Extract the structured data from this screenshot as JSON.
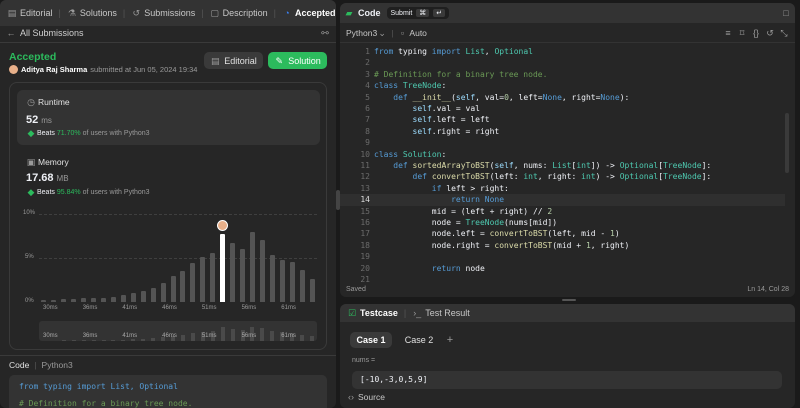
{
  "left_tabs": {
    "editorial": "Editorial",
    "solutions": "Solutions",
    "submissions": "Submissions",
    "description": "Description",
    "accepted": "Accepted"
  },
  "back_label": "All Submissions",
  "status": {
    "title": "Accepted",
    "user": "Aditya Raj Sharma",
    "submitted": "submitted at Jun 05, 2024 19:34"
  },
  "buttons": {
    "editorial": "Editorial",
    "solution": "Solution"
  },
  "runtime": {
    "label": "Runtime",
    "value": "52",
    "unit": "ms",
    "beats_prefix": "Beats",
    "beats_pct": "71.70%",
    "beats_suffix": "of users with Python3"
  },
  "memory": {
    "label": "Memory",
    "value": "17.68",
    "unit": "MB",
    "beats_prefix": "Beats",
    "beats_pct": "95.84%",
    "beats_suffix": "of users with Python3"
  },
  "chart_data": {
    "type": "bar",
    "yticks": [
      "10%",
      "5%",
      "0%"
    ],
    "ylim": [
      0,
      10
    ],
    "xticks": [
      "30ms",
      "36ms",
      "41ms",
      "46ms",
      "51ms",
      "56ms",
      "61ms"
    ],
    "mini_xticks": [
      "30ms",
      "36ms",
      "41ms",
      "46ms",
      "51ms",
      "56ms",
      "61ms"
    ],
    "values": [
      0.2,
      0.2,
      0.3,
      0.3,
      0.4,
      0.4,
      0.5,
      0.6,
      0.8,
      1.0,
      1.3,
      1.6,
      2.2,
      2.9,
      3.5,
      4.4,
      5.1,
      5.6,
      7.7,
      6.7,
      6.0,
      8.0,
      7.1,
      5.3,
      4.8,
      4.5,
      3.6,
      2.6
    ],
    "highlight_index": 18
  },
  "code_section": {
    "label": "Code",
    "lang": "Python3",
    "snippet_1": "from typing import List, Optional",
    "snippet_2": "# Definition for a binary tree node."
  },
  "editor": {
    "title": "Code",
    "submit": "Submit",
    "lang": "Python3",
    "auto": "Auto",
    "status_left": "Saved",
    "status_right": "Ln 14, Col 28",
    "lines": [
      "from typing import List, Optional",
      "",
      "# Definition for a binary tree node.",
      "class TreeNode:",
      "    def __init__(self, val=0, left=None, right=None):",
      "        self.val = val",
      "        self.left = left",
      "        self.right = right",
      "",
      "class Solution:",
      "    def sortedArrayToBST(self, nums: List[int]) -> Optional[TreeNode]:",
      "        def convertToBST(left: int, right: int) -> Optional[TreeNode]:",
      "            if left > right:",
      "                return None",
      "            mid = (left + right) // 2",
      "            node = TreeNode(nums[mid])",
      "            node.left = convertToBST(left, mid - 1)",
      "            node.right = convertToBST(mid + 1, right)",
      "",
      "            return node",
      ""
    ]
  },
  "testcase": {
    "tab1": "Testcase",
    "tab2": "Test Result",
    "case1": "Case 1",
    "case2": "Case 2",
    "add": "+",
    "var": "nums =",
    "value": "[-10,-3,0,5,9]",
    "source": "Source"
  }
}
